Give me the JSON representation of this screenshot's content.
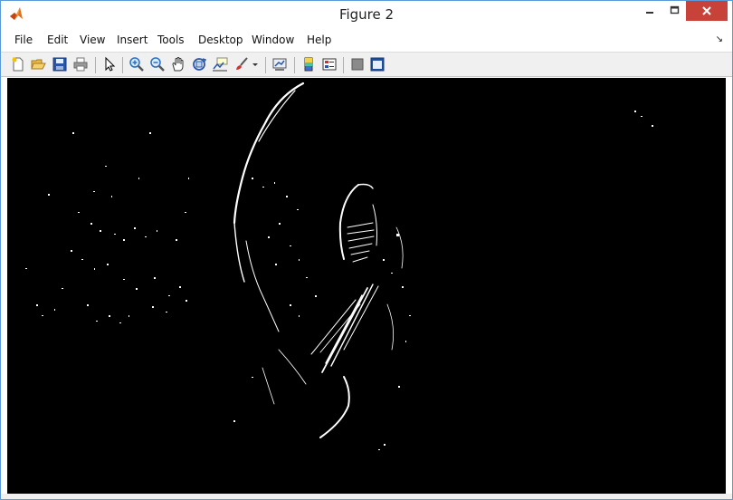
{
  "window": {
    "title": "Figure 2",
    "accent": "#5a9ad8",
    "close_color": "#c7433a"
  },
  "menubar": {
    "items": [
      "File",
      "Edit",
      "View",
      "Insert",
      "Tools",
      "Desktop",
      "Window",
      "Help"
    ],
    "overflow_icon": "chevron-icon"
  },
  "toolbar": {
    "buttons": [
      {
        "name": "new-figure-icon"
      },
      {
        "name": "open-file-icon"
      },
      {
        "name": "save-figure-icon"
      },
      {
        "name": "print-figure-icon"
      },
      {
        "name": "edit-plot-arrow-icon"
      },
      {
        "name": "zoom-in-icon"
      },
      {
        "name": "zoom-out-icon"
      },
      {
        "name": "pan-hand-icon"
      },
      {
        "name": "rotate-3d-icon"
      },
      {
        "name": "data-cursor-icon"
      },
      {
        "name": "brush-icon"
      },
      {
        "name": "link-plot-icon"
      },
      {
        "name": "insert-colorbar-icon"
      },
      {
        "name": "insert-legend-icon"
      },
      {
        "name": "hide-plot-tools-icon"
      },
      {
        "name": "show-plot-tools-icon"
      }
    ]
  },
  "figure": {
    "background": "#000000",
    "content": "edge-detected image (white edges on black)"
  }
}
